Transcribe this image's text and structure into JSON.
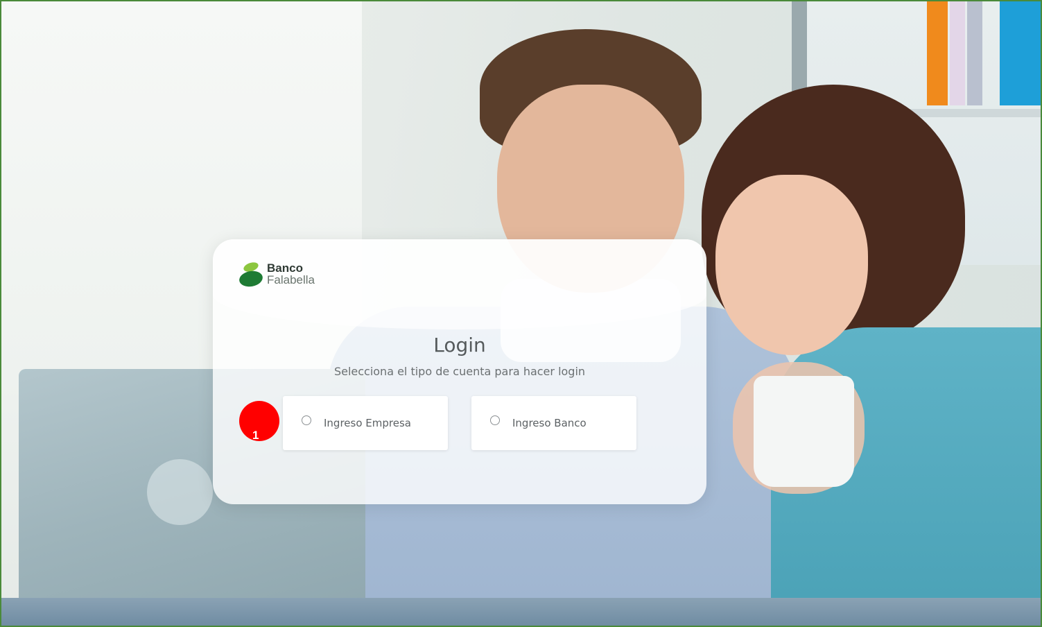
{
  "brand": {
    "line1": "Banco",
    "line2": "Falabella",
    "colors": {
      "leaf_light": "#8cc63f",
      "leaf_dark": "#1e7b34"
    }
  },
  "login": {
    "title": "Login",
    "subtitle": "Selecciona el tipo de cuenta para hacer login",
    "options": [
      {
        "label": "Ingreso Empresa",
        "selected": false
      },
      {
        "label": "Ingreso Banco",
        "selected": false
      }
    ]
  },
  "annotation": {
    "number": "1",
    "color": "#ff0000"
  },
  "theme": {
    "border": "#4a8a3a",
    "text": "#555a5c"
  }
}
